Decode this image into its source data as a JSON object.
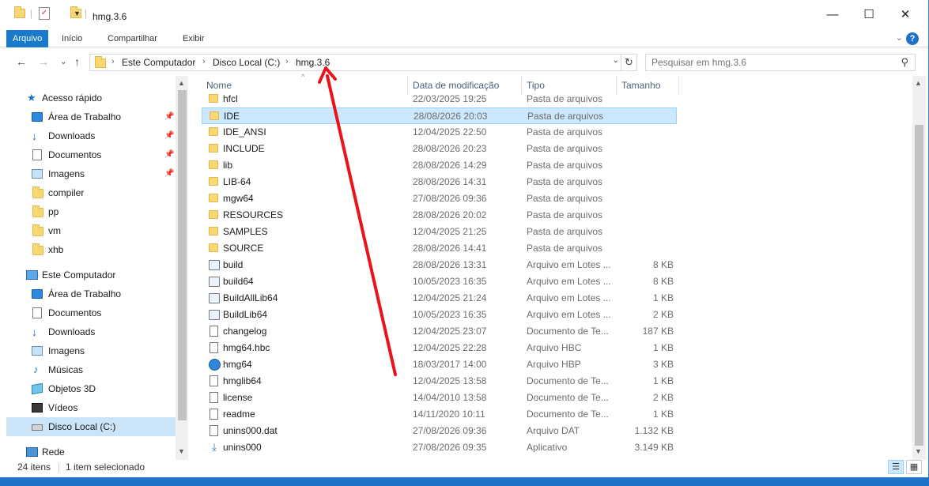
{
  "window": {
    "title": "hmg.3.6",
    "controls": {
      "minimize": "—",
      "maximize": "☐",
      "close": "✕"
    }
  },
  "ribbon": {
    "tabs": [
      "Arquivo",
      "Início",
      "Compartilhar",
      "Exibir"
    ],
    "collapse_icon": "chevron-down-icon",
    "help_label": "?"
  },
  "address": {
    "path": [
      "Este Computador",
      "Disco Local (C:)",
      "hmg.3.6"
    ],
    "search_placeholder": "Pesquisar em hmg.3.6"
  },
  "nav": {
    "quick_access_label": "Acesso rápido",
    "quick_access": [
      {
        "label": "Área de Trabalho",
        "icon": "desktop-icon",
        "pinned": true
      },
      {
        "label": "Downloads",
        "icon": "download-icon",
        "pinned": true
      },
      {
        "label": "Documentos",
        "icon": "documents-icon",
        "pinned": true
      },
      {
        "label": "Imagens",
        "icon": "pictures-icon",
        "pinned": true
      },
      {
        "label": "compiler",
        "icon": "folder-icon",
        "pinned": false
      },
      {
        "label": "pp",
        "icon": "folder-icon",
        "pinned": false
      },
      {
        "label": "vm",
        "icon": "folder-icon",
        "pinned": false
      },
      {
        "label": "xhb",
        "icon": "folder-icon",
        "pinned": false
      }
    ],
    "this_pc_label": "Este Computador",
    "this_pc": [
      {
        "label": "Área de Trabalho",
        "icon": "desktop-icon"
      },
      {
        "label": "Documentos",
        "icon": "documents-icon"
      },
      {
        "label": "Downloads",
        "icon": "download-icon"
      },
      {
        "label": "Imagens",
        "icon": "pictures-icon"
      },
      {
        "label": "Músicas",
        "icon": "music-icon"
      },
      {
        "label": "Objetos 3D",
        "icon": "objects-3d-icon"
      },
      {
        "label": "Vídeos",
        "icon": "videos-icon"
      },
      {
        "label": "Disco Local (C:)",
        "icon": "drive-icon",
        "selected": true
      }
    ],
    "network_label": "Rede"
  },
  "columns": [
    "Nome",
    "Data de modificação",
    "Tipo",
    "Tamanho"
  ],
  "files": [
    {
      "name": "hfcl",
      "date": "22/03/2025 19:25",
      "type": "Pasta de arquivos",
      "size": "",
      "icon": "folder-icon"
    },
    {
      "name": "IDE",
      "date": "28/08/2026 20:03",
      "type": "Pasta de arquivos",
      "size": "",
      "icon": "folder-icon",
      "selected": true
    },
    {
      "name": "IDE_ANSI",
      "date": "12/04/2025 22:50",
      "type": "Pasta de arquivos",
      "size": "",
      "icon": "folder-icon"
    },
    {
      "name": "INCLUDE",
      "date": "28/08/2026 20:23",
      "type": "Pasta de arquivos",
      "size": "",
      "icon": "folder-icon"
    },
    {
      "name": "lib",
      "date": "28/08/2026 14:29",
      "type": "Pasta de arquivos",
      "size": "",
      "icon": "folder-icon"
    },
    {
      "name": "LIB-64",
      "date": "28/08/2026 14:31",
      "type": "Pasta de arquivos",
      "size": "",
      "icon": "folder-icon"
    },
    {
      "name": "mgw64",
      "date": "27/08/2026 09:36",
      "type": "Pasta de arquivos",
      "size": "",
      "icon": "folder-icon"
    },
    {
      "name": "RESOURCES",
      "date": "28/08/2026 20:02",
      "type": "Pasta de arquivos",
      "size": "",
      "icon": "folder-icon"
    },
    {
      "name": "SAMPLES",
      "date": "12/04/2025 21:25",
      "type": "Pasta de arquivos",
      "size": "",
      "icon": "folder-icon"
    },
    {
      "name": "SOURCE",
      "date": "28/08/2026 14:41",
      "type": "Pasta de arquivos",
      "size": "",
      "icon": "folder-icon"
    },
    {
      "name": "build",
      "date": "28/08/2026 13:31",
      "type": "Arquivo em Lotes ...",
      "size": "8 KB",
      "icon": "batch-file-icon"
    },
    {
      "name": "build64",
      "date": "10/05/2023 16:35",
      "type": "Arquivo em Lotes ...",
      "size": "8 KB",
      "icon": "batch-file-icon"
    },
    {
      "name": "BuildAllLib64",
      "date": "12/04/2025 21:24",
      "type": "Arquivo em Lotes ...",
      "size": "1 KB",
      "icon": "batch-file-icon"
    },
    {
      "name": "BuildLib64",
      "date": "10/05/2023 16:35",
      "type": "Arquivo em Lotes ...",
      "size": "2 KB",
      "icon": "batch-file-icon"
    },
    {
      "name": "changelog",
      "date": "12/04/2025 23:07",
      "type": "Documento de Te...",
      "size": "187 KB",
      "icon": "text-file-icon"
    },
    {
      "name": "hmg64.hbc",
      "date": "12/04/2025 22:28",
      "type": "Arquivo HBC",
      "size": "1 KB",
      "icon": "file-icon"
    },
    {
      "name": "hmg64",
      "date": "18/03/2017 14:00",
      "type": "Arquivo HBP",
      "size": "3 KB",
      "icon": "hbp-file-icon"
    },
    {
      "name": "hmglib64",
      "date": "12/04/2025 13:58",
      "type": "Documento de Te...",
      "size": "1 KB",
      "icon": "text-file-icon"
    },
    {
      "name": "license",
      "date": "14/04/2010 13:58",
      "type": "Documento de Te...",
      "size": "2 KB",
      "icon": "text-file-icon"
    },
    {
      "name": "readme",
      "date": "14/11/2020 10:11",
      "type": "Documento de Te...",
      "size": "1 KB",
      "icon": "text-file-icon"
    },
    {
      "name": "unins000.dat",
      "date": "27/08/2026 09:36",
      "type": "Arquivo DAT",
      "size": "1.132 KB",
      "icon": "file-icon"
    },
    {
      "name": "unins000",
      "date": "27/08/2026 09:35",
      "type": "Aplicativo",
      "size": "3.149 KB",
      "icon": "application-icon"
    }
  ],
  "status": {
    "item_count": "24 itens",
    "selection": "1 item selecionado"
  },
  "colors": {
    "accent": "#1979ca",
    "selection": "#cce8ff",
    "annotation_arrow": "#e8141b"
  }
}
